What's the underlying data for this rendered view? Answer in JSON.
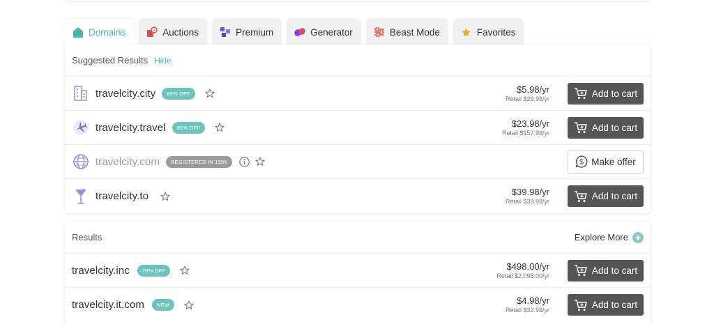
{
  "tabs": [
    {
      "label": "Domains",
      "icon": "house-icon"
    },
    {
      "label": "Auctions",
      "icon": "auction-icon"
    },
    {
      "label": "Premium",
      "icon": "premium-icon"
    },
    {
      "label": "Generator",
      "icon": "generator-icon"
    },
    {
      "label": "Beast Mode",
      "icon": "sliders-icon"
    },
    {
      "label": "Favorites",
      "icon": "star-icon"
    }
  ],
  "suggested": {
    "title": "Suggested Results",
    "hide_label": "Hide",
    "rows": [
      {
        "domain": "travelcity.city",
        "badge": "80% OFF",
        "price": "$5.98/yr",
        "retail": "Retail $29.98/yr",
        "button": "Add to cart"
      },
      {
        "domain": "travelcity.travel",
        "badge": "85% OFF",
        "price": "$23.98/yr",
        "retail": "Retail $157.98/yr",
        "button": "Add to cart"
      },
      {
        "domain": "travelcity.com",
        "badge": "REGISTERED IN 1995",
        "button": "Make offer"
      },
      {
        "domain": "travelcity.to",
        "price": "$39.98/yr",
        "retail": "Retail $39.98/yr",
        "button": "Add to cart"
      }
    ]
  },
  "results": {
    "title": "Results",
    "explore_label": "Explore More",
    "rows": [
      {
        "domain": "travelcity.inc",
        "badge": "76% OFF",
        "price": "$498.00/yr",
        "retail": "Retail $2,098.00/yr",
        "button": "Add to cart"
      },
      {
        "domain": "travelcity.it.com",
        "badge": "NEW",
        "price": "$4.98/yr",
        "retail": "Retail $32.98/yr",
        "button": "Add to cart"
      }
    ]
  },
  "colors": {
    "accent": "#4fb3ad",
    "badge": "#6cc4bd",
    "button_dark": "#555555",
    "badge_grey": "#9b9b9b"
  }
}
